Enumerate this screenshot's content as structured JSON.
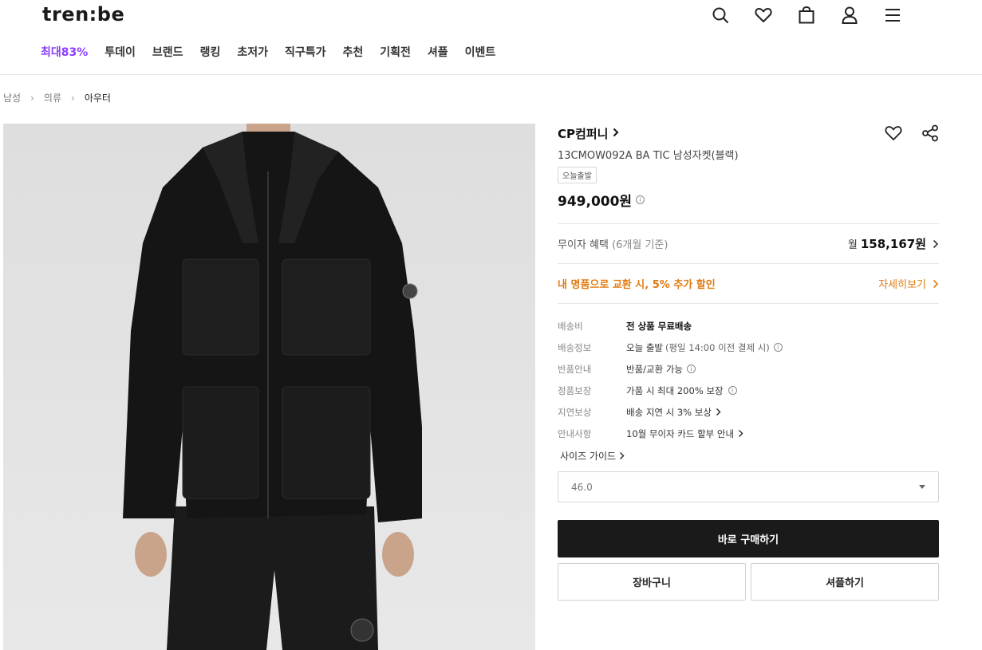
{
  "header": {
    "logo": "tren:be",
    "icons": [
      "search-icon",
      "heart-icon",
      "shopping-bag-icon",
      "user-icon",
      "menu-icon"
    ],
    "nav": [
      {
        "label": "최대83%",
        "highlight": true
      },
      {
        "label": "투데이"
      },
      {
        "label": "브랜드"
      },
      {
        "label": "랭킹"
      },
      {
        "label": "초저가"
      },
      {
        "label": "직구특가"
      },
      {
        "label": "추천"
      },
      {
        "label": "기획전"
      },
      {
        "label": "셔플"
      },
      {
        "label": "이벤트"
      }
    ]
  },
  "breadcrumb": [
    "남성",
    "의류",
    "아우터"
  ],
  "product": {
    "brand": "CP컴퍼니",
    "name": "13CMOW092A BA TIC 남성자켓(블랙)",
    "badge": "오늘출발",
    "price": "949,000원",
    "installment": {
      "label": "무이자 혜택",
      "sub": "(6개월 기준)",
      "prefix": "월",
      "value": "158,167원"
    },
    "exchange": {
      "label": "내 명품으로 교환 시, 5% 추가 할인",
      "link": "자세히보기"
    },
    "details": [
      {
        "key": "배송비",
        "value": "전 상품 무료배송",
        "bold": true
      },
      {
        "key": "배송정보",
        "value": "오늘 출발",
        "extra": "(평일 14:00 이전 결제 시)",
        "icon": "info-icon"
      },
      {
        "key": "반품안내",
        "value": "반품/교환 가능",
        "icon": "info-icon"
      },
      {
        "key": "정품보장",
        "value": "가품 시 최대 200% 보장",
        "icon": "info-icon"
      },
      {
        "key": "지연보상",
        "value": "배송 지연 시 3% 보상",
        "icon": "chevron-right-icon"
      },
      {
        "key": "안내사항",
        "value": "10월 무이자 카드 할부 안내",
        "icon": "chevron-right-icon"
      }
    ],
    "size_guide": "사이즈 가이드",
    "selected_size": "46.0"
  },
  "actions": {
    "buy": "바로 구매하기",
    "cart": "장바구니",
    "shuffle": "셔플하기"
  },
  "colors": {
    "accent": "#8a3ffc",
    "exchange": "#e07b12",
    "buy_button": "#1a1a1a"
  }
}
